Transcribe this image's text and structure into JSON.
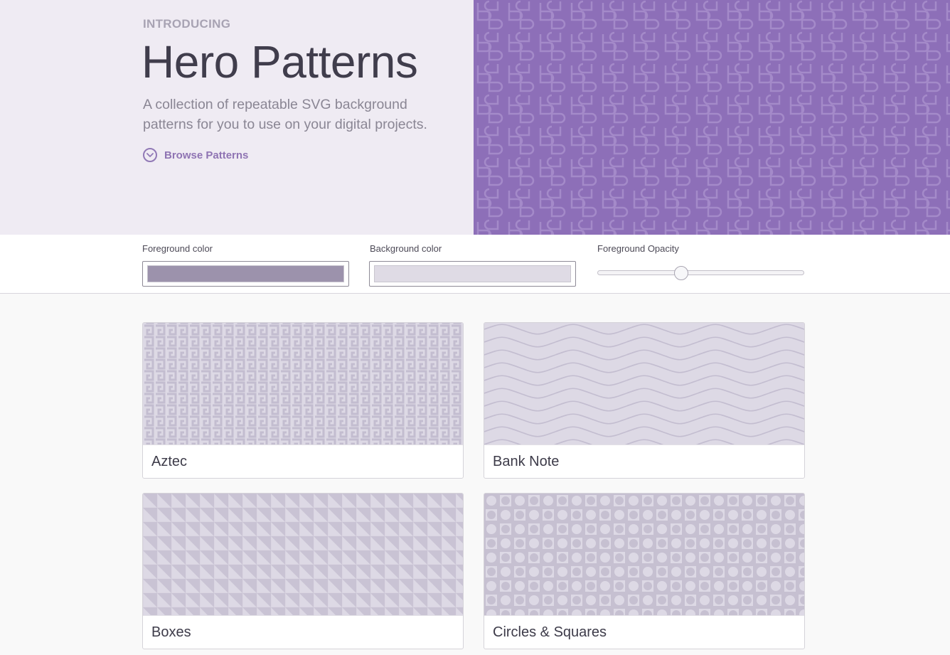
{
  "hero": {
    "eyebrow": "INTRODUCING",
    "title": "Hero Patterns",
    "lede": "A collection of repeatable SVG background patterns for you to use on your digital projects.",
    "browse_label": "Browse Patterns",
    "browse_icon": "chevron-down-circle-icon",
    "pattern_color": "#8d6fb8"
  },
  "controls": {
    "foreground_label": "Foreground color",
    "foreground_color": "#9c92ac",
    "background_label": "Background color",
    "background_color": "#dfdbe5",
    "opacity_label": "Foreground Opacity",
    "opacity_value": 0.4
  },
  "patterns": [
    {
      "name": "Aztec"
    },
    {
      "name": "Bank Note"
    },
    {
      "name": "Boxes"
    },
    {
      "name": "Circles & Squares"
    }
  ]
}
